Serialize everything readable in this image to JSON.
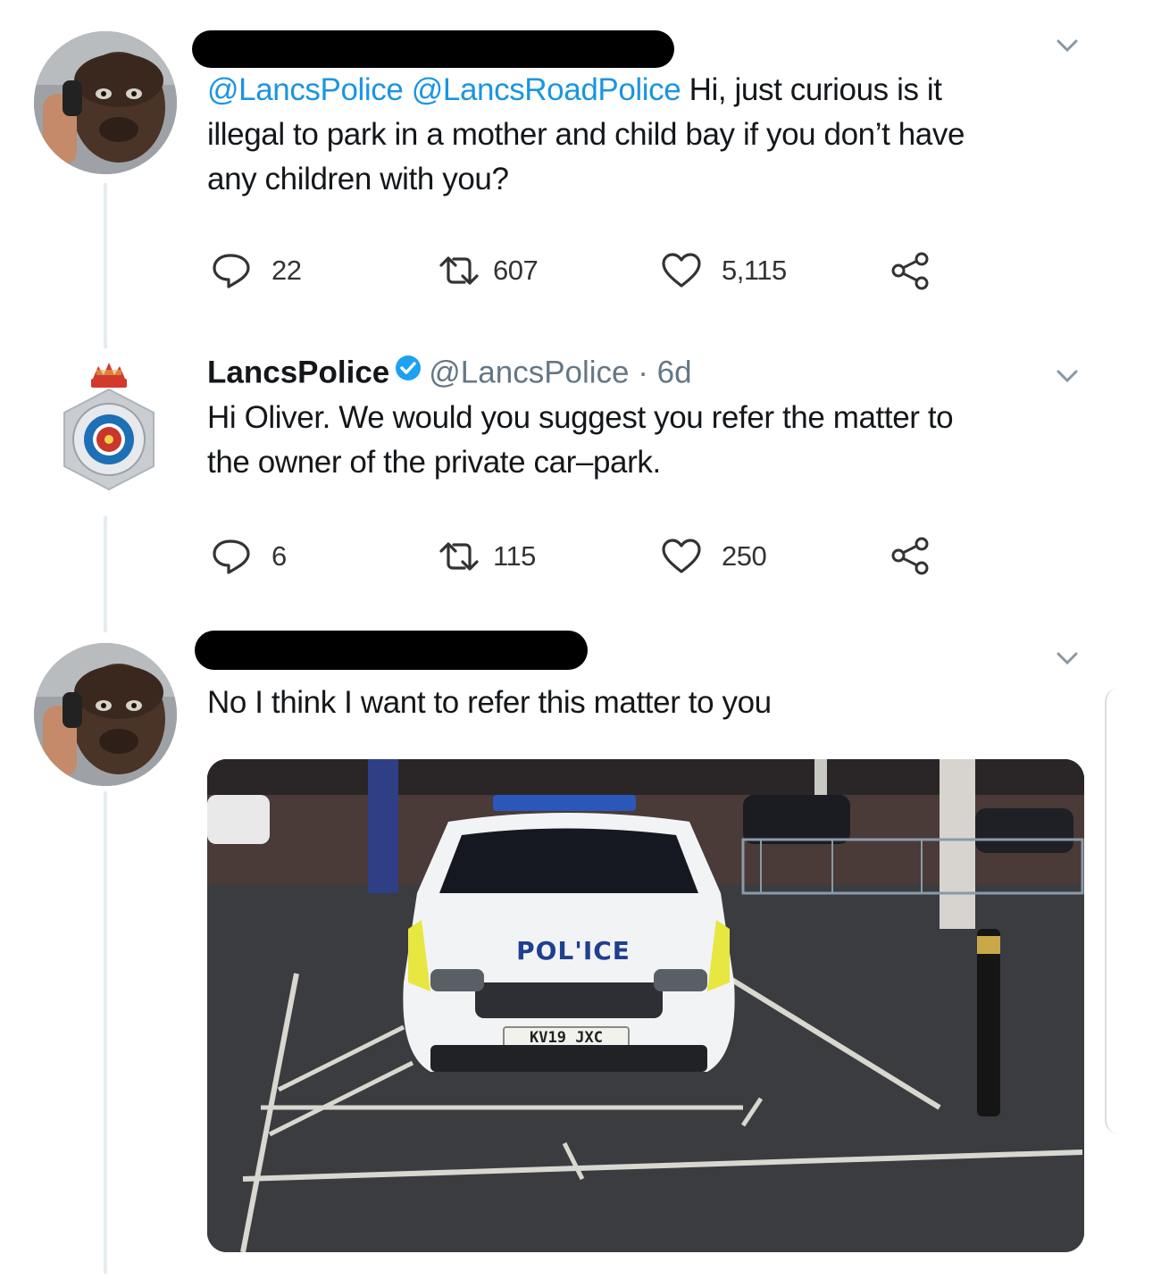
{
  "tweets": [
    {
      "mention_1": "@LancsPolice",
      "mention_2": "@LancsRoadPolice",
      "text_line_1": " Hi, just curious is it",
      "text_line_2": "illegal to park in a mother and child bay if you don’t have",
      "text_line_3": "any children with you?",
      "reply_count": "22",
      "retweet_count": "607",
      "like_count": "5,115"
    },
    {
      "display_name": "LancsPolice",
      "handle": "@LancsPolice",
      "separator": " · ",
      "time": "6d",
      "text_line_1": "Hi Oliver. We would you suggest you refer the matter to",
      "text_line_2": "the owner of the private car–park.",
      "reply_count": "6",
      "retweet_count": "115",
      "like_count": "250"
    },
    {
      "text_line_1": "No I think I want to refer this matter to you",
      "photo": {
        "car_label": "POL'ICE",
        "plate": "KV19 JXC"
      }
    }
  ],
  "icons": {
    "reply": "reply-icon",
    "retweet": "retweet-icon",
    "like": "heart-icon",
    "share": "share-icon",
    "caret": "chevron-down-icon",
    "verified": "verified-badge-icon"
  },
  "colors": {
    "link": "#1b95e0",
    "text": "#14171a",
    "muted": "#657786",
    "verified": "#1da1f2"
  }
}
